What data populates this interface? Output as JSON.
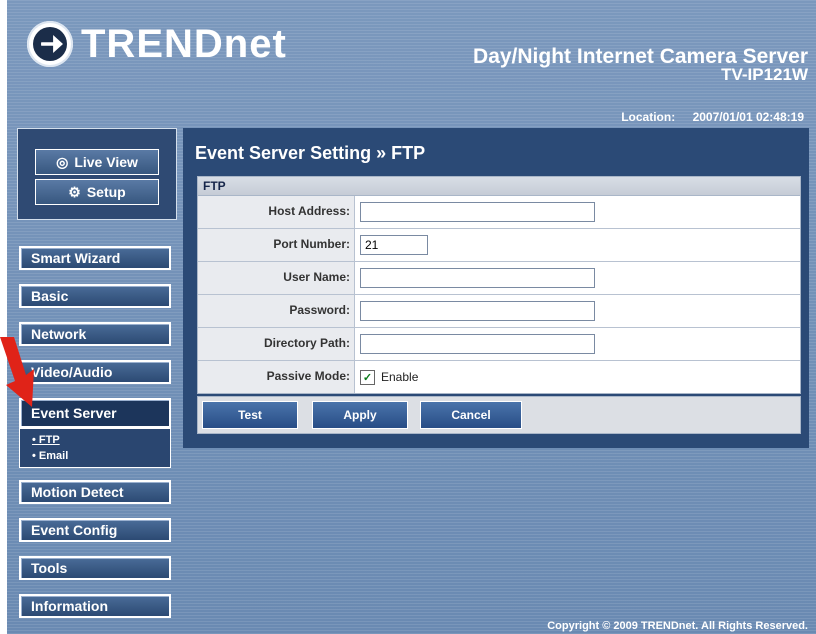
{
  "header": {
    "logo_text": "TRENDnet",
    "product_title": "Day/Night Internet Camera Server",
    "model": "TV-IP121W",
    "location_label": "Location:",
    "datetime": "2007/01/01 02:48:19"
  },
  "nav_top": {
    "live_view": "Live View",
    "setup": "Setup"
  },
  "sidebar": {
    "items": [
      {
        "label": "Smart Wizard"
      },
      {
        "label": "Basic"
      },
      {
        "label": "Network"
      },
      {
        "label": "Video/Audio"
      },
      {
        "label": "Event Server"
      },
      {
        "label": "Motion Detect"
      },
      {
        "label": "Event Config"
      },
      {
        "label": "Tools"
      },
      {
        "label": "Information"
      }
    ],
    "submenu": [
      {
        "label": "• FTP"
      },
      {
        "label": "• Email"
      }
    ]
  },
  "panel": {
    "title": "Event Server Setting » FTP",
    "section": "FTP",
    "fields": {
      "host_label": "Host Address:",
      "host_value": "",
      "port_label": "Port Number:",
      "port_value": "21",
      "user_label": "User Name:",
      "user_value": "",
      "password_label": "Password:",
      "password_value": "",
      "dir_label": "Directory Path:",
      "dir_value": "",
      "passive_label": "Passive Mode:",
      "passive_enable": "Enable"
    },
    "buttons": {
      "test": "Test",
      "apply": "Apply",
      "cancel": "Cancel"
    }
  },
  "footer": {
    "copyright": "Copyright © 2009 TRENDnet. All Rights Reserved."
  },
  "colors": {
    "accent": "#2b4a76",
    "arrow": "#e02318",
    "check": "#0a7a18"
  }
}
